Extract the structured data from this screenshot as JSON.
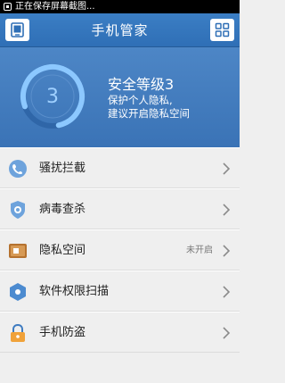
{
  "status_bar": {
    "text": "正在保存屏幕截图..."
  },
  "title_bar": {
    "title": "手机管家"
  },
  "security": {
    "level_number": "3",
    "title": "安全等级3",
    "description_line1": "保护个人隐私,",
    "description_line2": "建议开启隐私空间"
  },
  "menu": {
    "items": [
      {
        "label": "骚扰拦截",
        "status": "",
        "icon": "phone-shield-icon"
      },
      {
        "label": "病毒查杀",
        "status": "",
        "icon": "virus-scan-icon"
      },
      {
        "label": "隐私空间",
        "status": "未开启",
        "icon": "privacy-safe-icon"
      },
      {
        "label": "软件权限扫描",
        "status": "",
        "icon": "permission-scan-icon"
      },
      {
        "label": "手机防盗",
        "status": "",
        "icon": "anti-theft-lock-icon"
      }
    ]
  },
  "colors": {
    "accent": "#3a73b6",
    "ring": "#9fd0ff"
  }
}
